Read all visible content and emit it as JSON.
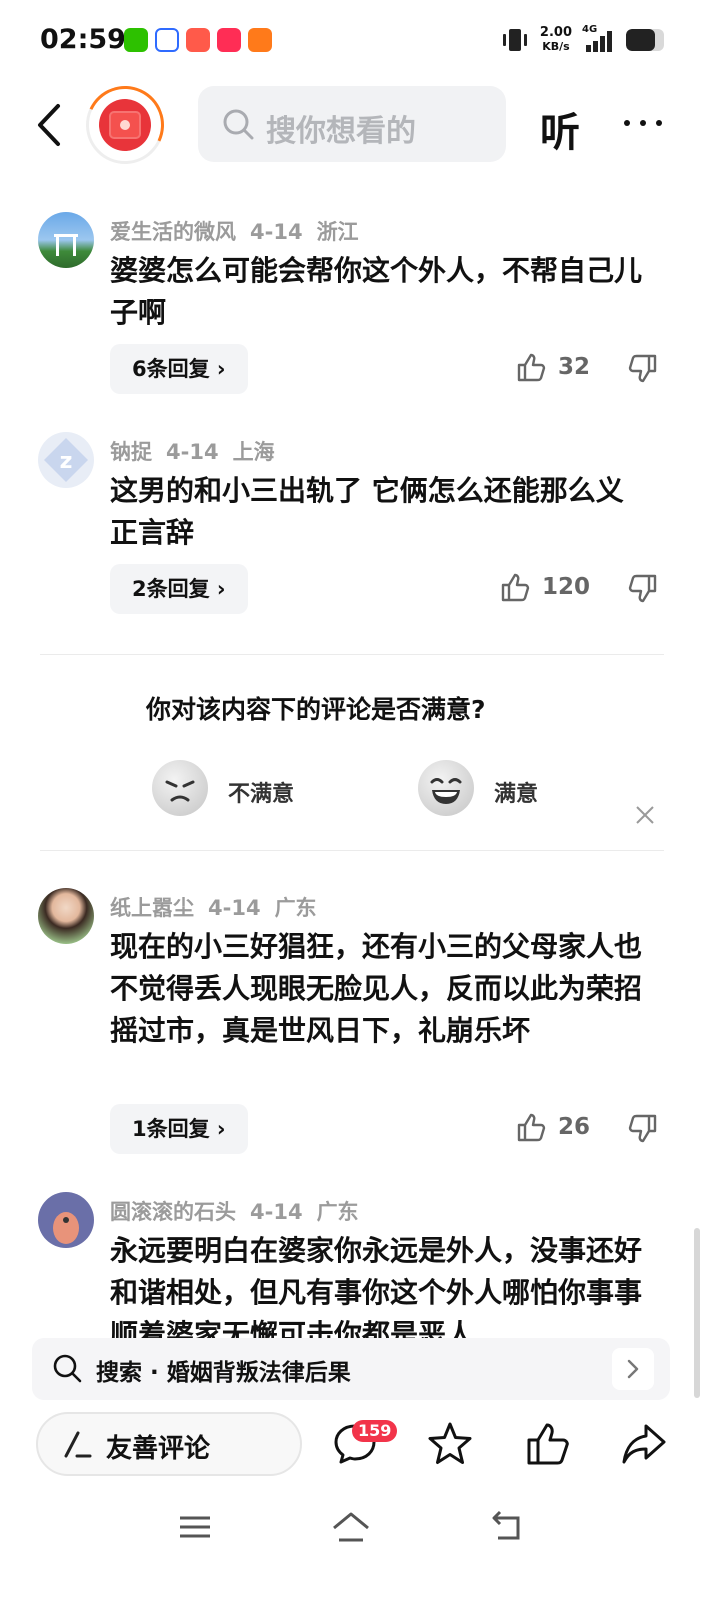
{
  "status_bar": {
    "time": "02:59",
    "net_speed_value": "2.00",
    "net_speed_unit": "KB/s",
    "network": "4G",
    "battery_percent": 75,
    "app_icons": [
      "wechat-icon",
      "baidu-icon",
      "app-icon",
      "heart-app-icon",
      "photo-app-icon"
    ]
  },
  "header": {
    "search_placeholder": "搜你想看的",
    "listen_label": "听"
  },
  "comments": [
    {
      "author": "爱生活的微风",
      "date": "4-14",
      "location": "浙江",
      "text": "婆婆怎么可能会帮你这个外人，不帮自己儿子啊",
      "replies": "6条回复",
      "likes": "32"
    },
    {
      "author": "钠捉",
      "date": "4-14",
      "location": "上海",
      "text": "这男的和小三出轨了 它俩怎么还能那么义正言辞",
      "replies": "2条回复",
      "likes": "120"
    },
    {
      "author": "纸上嚣尘",
      "date": "4-14",
      "location": "广东",
      "text": "现在的小三好猖狂，还有小三的父母家人也不觉得丢人现眼无脸见人，反而以此为荣招摇过市，真是世风日下，礼崩乐坏",
      "replies": "1条回复",
      "likes": "26"
    },
    {
      "author": "圆滚滚的石头",
      "date": "4-14",
      "location": "广东",
      "text": "永远要明白在婆家你永远是外人，没事还好和谐相处，但凡有事你这个外人哪怕你事事顺着婆家无懈可击你都是恶人"
    }
  ],
  "survey": {
    "question": "你对该内容下的评论是否满意?",
    "unsatisfied": "不满意",
    "satisfied": "满意"
  },
  "suggest": {
    "text": "搜索 · 婚姻背叛法律后果"
  },
  "action_bar": {
    "comment_label": "友善评论",
    "comment_count": "159"
  }
}
